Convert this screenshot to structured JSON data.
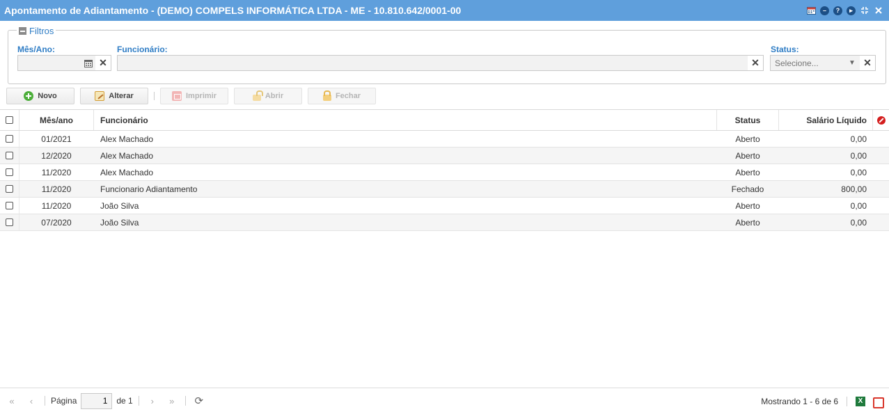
{
  "window": {
    "title": "Apontamento de Adiantamento - (DEMO) COMPELS INFORMÁTICA LTDA - ME - 10.810.642/0001-00",
    "title_icons": [
      "calendar-icon",
      "minimize-circle-icon",
      "help-icon",
      "play-icon",
      "collapse-icon",
      "close-icon"
    ]
  },
  "filters": {
    "legend": "Filtros",
    "mes_ano": {
      "label": "Mês/Ano:",
      "value": ""
    },
    "funcionario": {
      "label": "Funcionário:",
      "value": ""
    },
    "status": {
      "label": "Status:",
      "placeholder": "Selecione..."
    }
  },
  "toolbar": {
    "novo": "Novo",
    "alterar": "Alterar",
    "imprimir": "Imprimir",
    "abrir": "Abrir",
    "fechar": "Fechar"
  },
  "grid": {
    "columns": {
      "mes_ano": "Mês/ano",
      "funcionario": "Funcionário",
      "status": "Status",
      "salario": "Salário Líquido"
    },
    "rows": [
      {
        "mes_ano": "01/2021",
        "funcionario": "Alex Machado",
        "status": "Aberto",
        "salario": "0,00"
      },
      {
        "mes_ano": "12/2020",
        "funcionario": "Alex Machado",
        "status": "Aberto",
        "salario": "0,00"
      },
      {
        "mes_ano": "11/2020",
        "funcionario": "Alex Machado",
        "status": "Aberto",
        "salario": "0,00"
      },
      {
        "mes_ano": "11/2020",
        "funcionario": "Funcionario Adiantamento",
        "status": "Fechado",
        "salario": "800,00"
      },
      {
        "mes_ano": "11/2020",
        "funcionario": "João Silva",
        "status": "Aberto",
        "salario": "0,00"
      },
      {
        "mes_ano": "07/2020",
        "funcionario": "João Silva",
        "status": "Aberto",
        "salario": "0,00"
      }
    ]
  },
  "pager": {
    "page_label": "Página",
    "page_value": "1",
    "of_label": "de 1",
    "summary": "Mostrando 1 - 6 de 6"
  }
}
